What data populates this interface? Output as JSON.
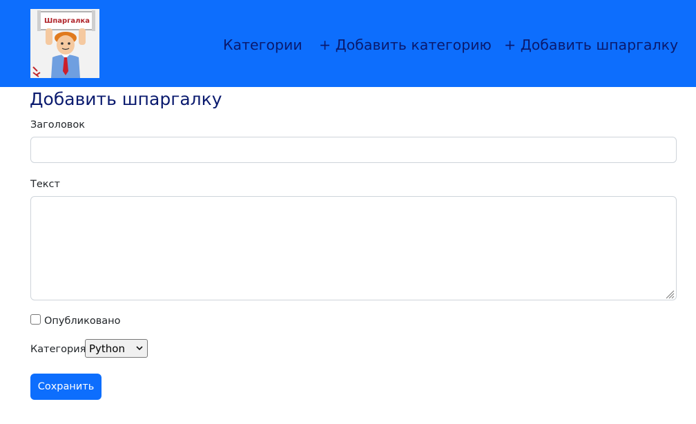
{
  "navbar": {
    "logo_text": "Шпаргалка",
    "links": [
      {
        "label": "Категории"
      },
      {
        "label": "+ Добавить категорию"
      },
      {
        "label": "+ Добавить шпаргалку"
      }
    ],
    "background": "#0d6efd",
    "link_color": "#0a1a6e"
  },
  "form": {
    "title": "Добавить шпаргалку",
    "title_label": "Заголовок",
    "title_value": "",
    "text_label": "Текст",
    "text_value": "",
    "published_label": "Опубликовано",
    "published_checked": false,
    "category_label": "Категория",
    "category_selected": "Python",
    "submit_label": "Сохранить",
    "accent": "#0d6efd"
  }
}
